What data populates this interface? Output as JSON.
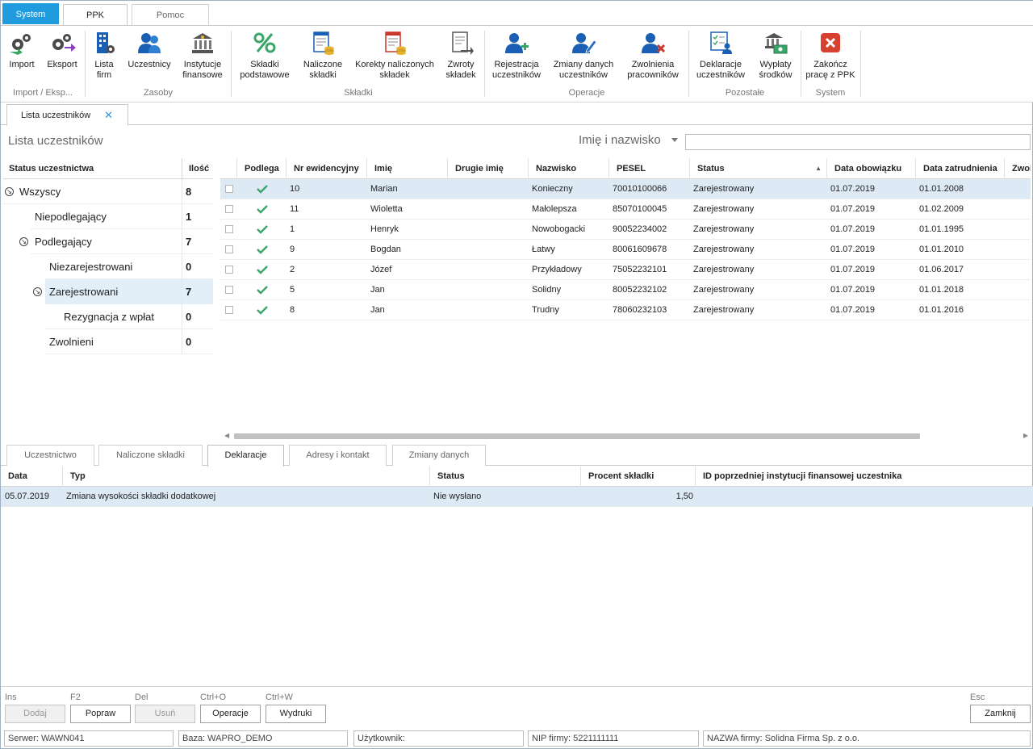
{
  "ribbon_tabs": [
    "System",
    "PPK",
    "Pomoc"
  ],
  "ribbon": {
    "buttons": [
      {
        "l1": "Import",
        "l2": ""
      },
      {
        "l1": "Eksport",
        "l2": ""
      },
      {
        "l1": "Lista",
        "l2": "firm"
      },
      {
        "l1": "Uczestnicy",
        "l2": ""
      },
      {
        "l1": "Instytucje",
        "l2": "finansowe"
      },
      {
        "l1": "Składki",
        "l2": "podstawowe"
      },
      {
        "l1": "Naliczone",
        "l2": "składki"
      },
      {
        "l1": "Korekty naliczonych",
        "l2": "składek"
      },
      {
        "l1": "Zwroty",
        "l2": "składek"
      },
      {
        "l1": "Rejestracja",
        "l2": "uczestników"
      },
      {
        "l1": "Zmiany danych",
        "l2": "uczestników"
      },
      {
        "l1": "Zwolnienia",
        "l2": "pracowników"
      },
      {
        "l1": "Deklaracje",
        "l2": "uczestników"
      },
      {
        "l1": "Wypłaty",
        "l2": "środków"
      },
      {
        "l1": "Zakończ",
        "l2": "pracę z PPK"
      }
    ],
    "groups": [
      "Import / Eksp...",
      "Zasoby",
      "Składki",
      "Operacje",
      "Pozostałe",
      "System"
    ]
  },
  "doc_tab": "Lista uczestników",
  "page_title": "Lista uczestników",
  "filter": {
    "label": "Imię i nazwisko",
    "value": ""
  },
  "tree": {
    "col_status": "Status uczestnictwa",
    "col_count": "Ilość",
    "rows": [
      {
        "label": "Wszyscy",
        "count": "8"
      },
      {
        "label": "Niepodlegający",
        "count": "1"
      },
      {
        "label": "Podlegający",
        "count": "7"
      },
      {
        "label": "Niezarejestrowani",
        "count": "0"
      },
      {
        "label": "Zarejestrowani",
        "count": "7"
      },
      {
        "label": "Rezygnacja z wpłat",
        "count": "0"
      },
      {
        "label": "Zwolnieni",
        "count": "0"
      }
    ]
  },
  "grid": {
    "columns": [
      "Podlega",
      "Nr ewidencyjny",
      "Imię",
      "Drugie imię",
      "Nazwisko",
      "PESEL",
      "Status",
      "Data obowiązku",
      "Data zatrudnienia",
      "Zwol"
    ],
    "rows": [
      {
        "nr": "10",
        "imie": "Marian",
        "drugie": "",
        "nazwisko": "Konieczny",
        "pesel": "70010100066",
        "status": "Zarejestrowany",
        "obow": "01.07.2019",
        "zatr": "01.01.2008"
      },
      {
        "nr": "11",
        "imie": "Wioletta",
        "drugie": "",
        "nazwisko": "Małolepsza",
        "pesel": "85070100045",
        "status": "Zarejestrowany",
        "obow": "01.07.2019",
        "zatr": "01.02.2009"
      },
      {
        "nr": "1",
        "imie": "Henryk",
        "drugie": "",
        "nazwisko": "Nowobogacki",
        "pesel": "90052234002",
        "status": "Zarejestrowany",
        "obow": "01.07.2019",
        "zatr": "01.01.1995"
      },
      {
        "nr": "9",
        "imie": "Bogdan",
        "drugie": "",
        "nazwisko": "Łatwy",
        "pesel": "80061609678",
        "status": "Zarejestrowany",
        "obow": "01.07.2019",
        "zatr": "01.01.2010"
      },
      {
        "nr": "2",
        "imie": "Józef",
        "drugie": "",
        "nazwisko": "Przykładowy",
        "pesel": "75052232101",
        "status": "Zarejestrowany",
        "obow": "01.07.2019",
        "zatr": "01.06.2017"
      },
      {
        "nr": "5",
        "imie": "Jan",
        "drugie": "",
        "nazwisko": "Solidny",
        "pesel": "80052232102",
        "status": "Zarejestrowany",
        "obow": "01.07.2019",
        "zatr": "01.01.2018"
      },
      {
        "nr": "8",
        "imie": "Jan",
        "drugie": "",
        "nazwisko": "Trudny",
        "pesel": "78060232103",
        "status": "Zarejestrowany",
        "obow": "01.07.2019",
        "zatr": "01.01.2016"
      }
    ]
  },
  "bottom_tabs": [
    "Uczestnictwo",
    "Naliczone składki",
    "Deklaracje",
    "Adresy i kontakt",
    "Zmiany danych"
  ],
  "bottom_grid": {
    "columns": [
      "Data",
      "Typ",
      "Status",
      "Procent składki",
      "ID poprzedniej instytucji finansowej uczestnika"
    ],
    "rows": [
      {
        "data": "05.07.2019",
        "typ": "Zmiana wysokości składki dodatkowej",
        "status": "Nie wysłano",
        "procent": "1,50",
        "id": ""
      }
    ]
  },
  "footer": {
    "hotkeys": [
      "Ins",
      "F2",
      "Del",
      "Ctrl+O",
      "Ctrl+W",
      "Esc"
    ],
    "buttons": [
      "Dodaj",
      "Popraw",
      "Usuń",
      "Operacje",
      "Wydruki",
      "Zamknij"
    ]
  },
  "statusbar": {
    "server": "Serwer: WAWN041",
    "db": "Baza: WAPRO_DEMO",
    "user": "Użytkownik:",
    "nip": "NIP firmy: 5221111111",
    "company": "NAZWA firmy: Solidna Firma Sp. z o.o."
  },
  "colors": {
    "accent": "#1f9bde",
    "selection": "#dde9f4",
    "check": "#3aa66a",
    "icon_blue": "#1a5fb4"
  }
}
